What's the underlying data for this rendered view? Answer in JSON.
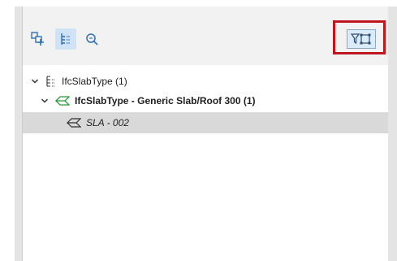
{
  "toolbar": {
    "buttons": [
      {
        "name": "add-elements-button",
        "icon": "add-elements-icon"
      },
      {
        "name": "tree-view-button",
        "icon": "tree-view-icon",
        "active": true
      },
      {
        "name": "zoom-button",
        "icon": "zoom-icon"
      }
    ],
    "filter_button": {
      "icon": "filter-selection-icon"
    },
    "highlight_color": "#c0151d"
  },
  "tree": {
    "items": [
      {
        "label": "IfcSlabType (1)",
        "icon": "type-tree-icon",
        "expanded": true,
        "bold": false
      },
      {
        "label": "IfcSlabType - Generic Slab/Roof 300 (1)",
        "icon": "slab-type-icon",
        "expanded": true,
        "bold": true
      },
      {
        "label": "SLA - 002",
        "icon": "slab-element-icon",
        "selected": true,
        "italic": true
      }
    ]
  }
}
